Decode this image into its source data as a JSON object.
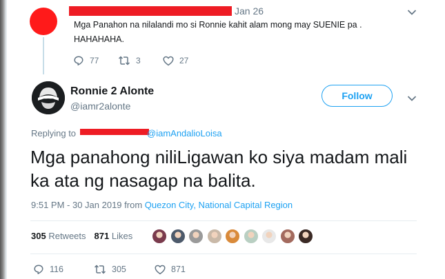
{
  "reply_tweet": {
    "date": "Jan 26",
    "text": "Mga Panahon na nilalandi mo si Ronnie kahit alam mong may SUENIE pa . HAHAHAHA.",
    "replies": "77",
    "retweets": "3",
    "likes": "27"
  },
  "main_tweet": {
    "display_name": "Ronnie 2 Alonte",
    "handle": "@iamr2alonte",
    "follow_label": "Follow",
    "replying_to_label": "Replying to",
    "replying_to_mention": "@iamAndalioLoisa",
    "text": "Mga panahong niliLigawan ko siya madam mali ka ata ng nasagap na balita.",
    "timestamp": "9:51 PM - 30 Jan 2019 from ",
    "location": "Quezon City, National Capital Region",
    "retweet_count": "305",
    "retweets_label": "Retweets",
    "like_count": "871",
    "likes_label": "Likes",
    "action_replies": "116",
    "action_retweets": "305",
    "action_likes": "871"
  },
  "icons": {
    "reply": "reply-icon",
    "retweet": "retweet-icon",
    "like": "heart-icon",
    "caret": "chevron-down-icon"
  },
  "colors": {
    "accent": "#1da1f2",
    "muted": "#657786",
    "text": "#14171a",
    "redaction": "#ee1c24"
  },
  "likers_avatar_colors": [
    "#7a3b4d",
    "#4d5a6b",
    "#9a9a9a",
    "#c9b9a8",
    "#d98a3a",
    "#b9cfc2",
    "#e8e8e8",
    "#a36a5e",
    "#3b2a25"
  ]
}
